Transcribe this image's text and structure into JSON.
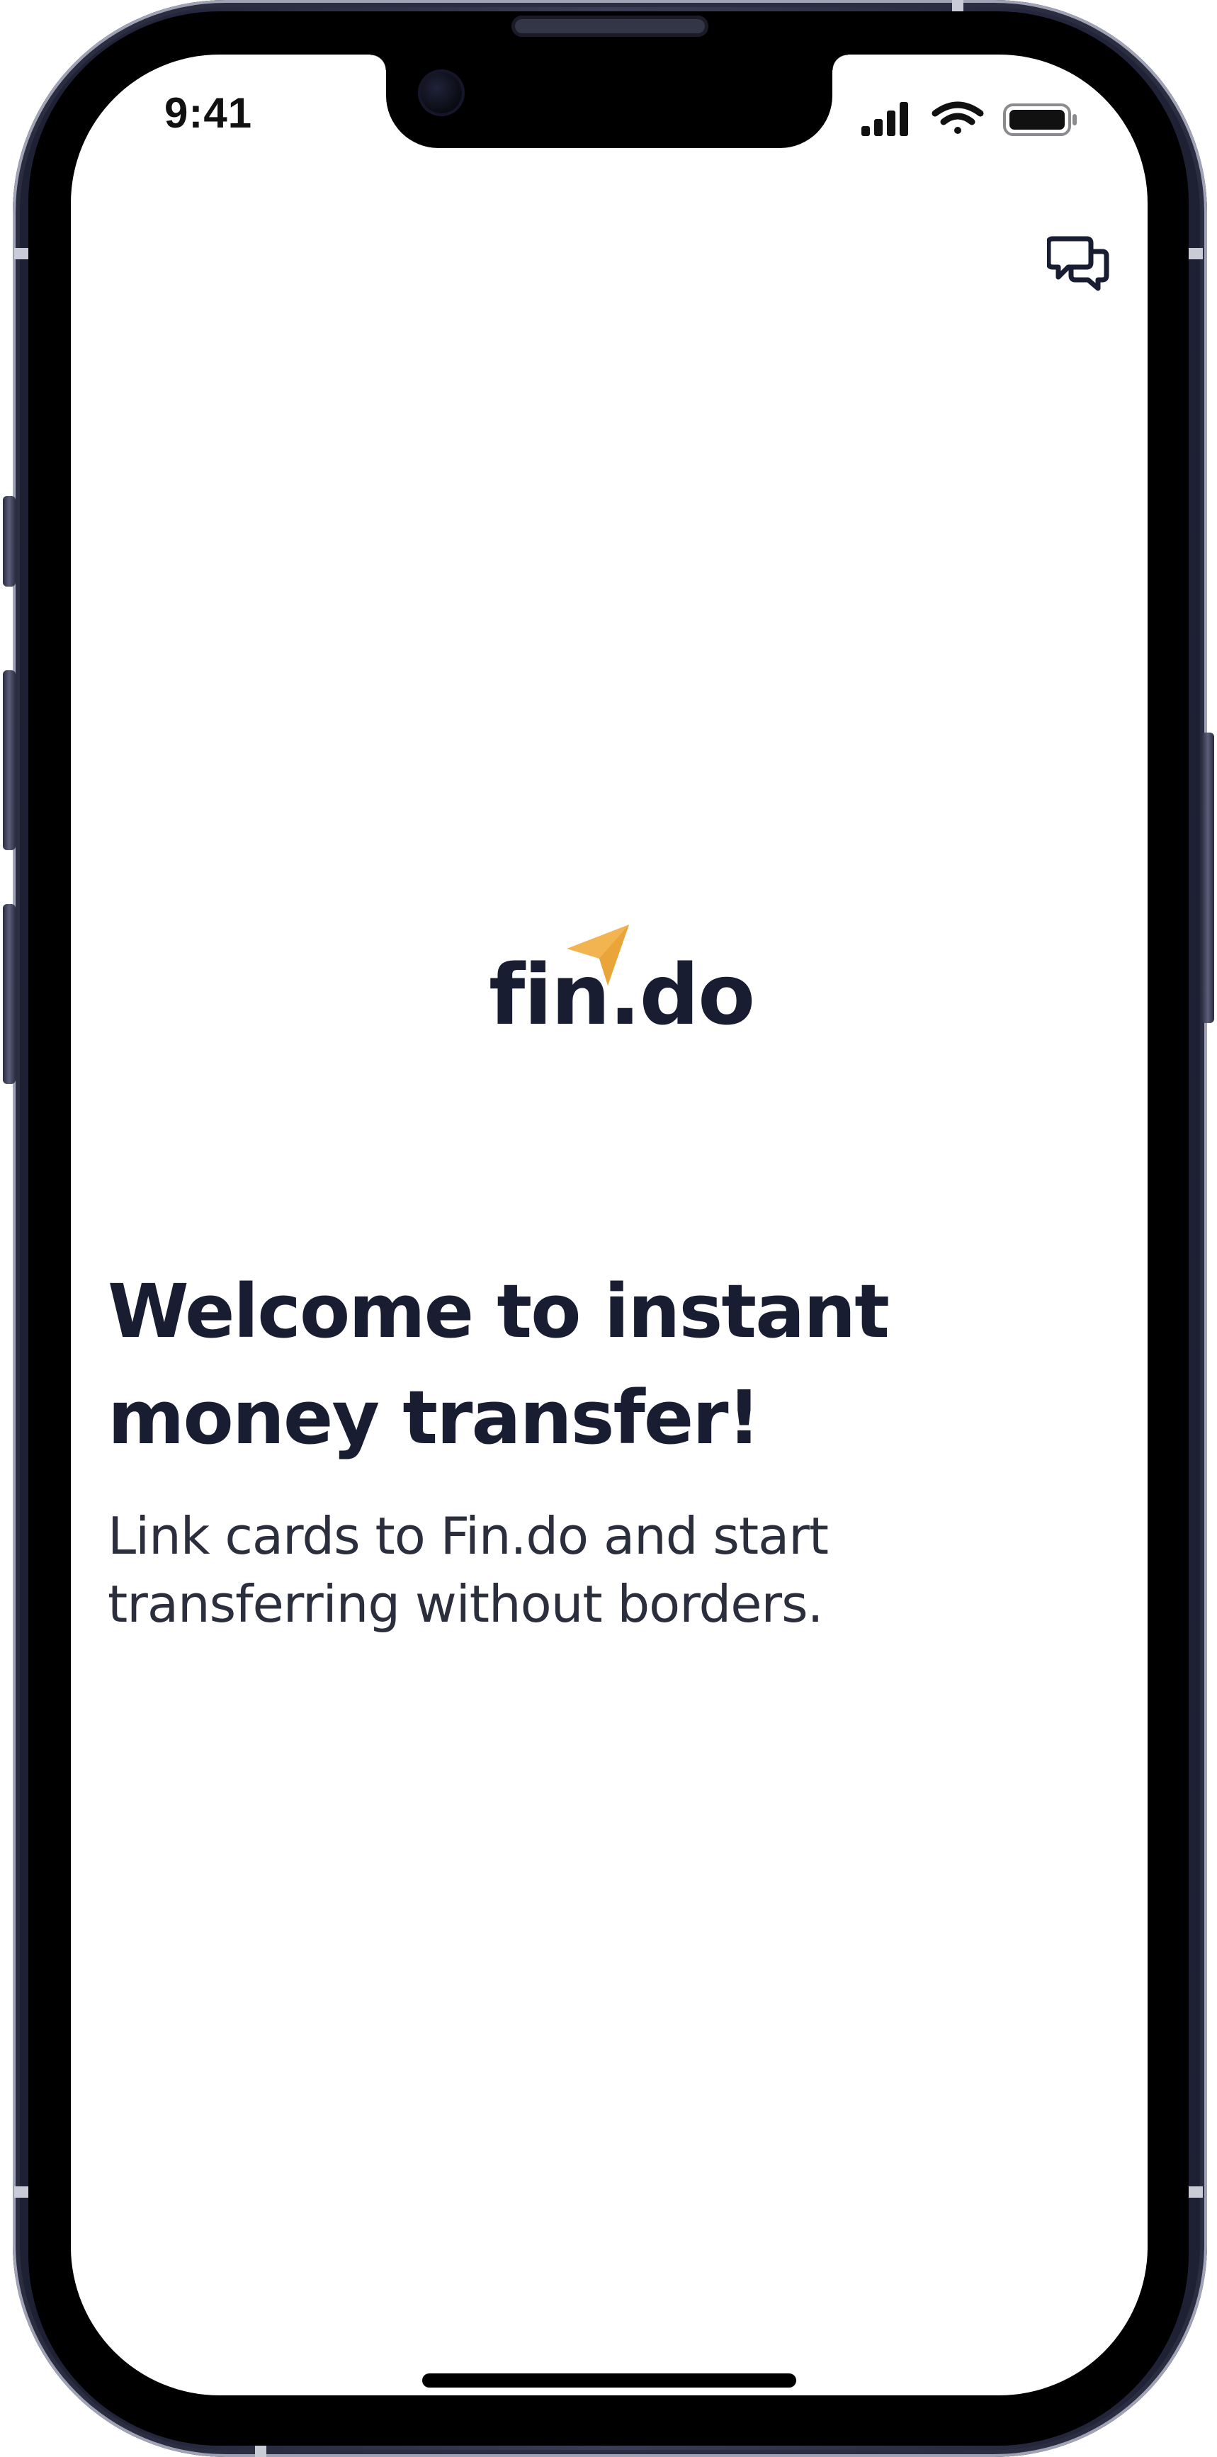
{
  "status_bar": {
    "time": "9:41",
    "signal_icon": "cellular-signal-icon",
    "wifi_icon": "wifi-icon",
    "battery_icon": "battery-icon"
  },
  "header": {
    "support_icon": "chat-bubbles-icon"
  },
  "brand": {
    "logo_text": "fin.do",
    "logo_icon": "paper-plane-icon",
    "accent_color": "#F2B451",
    "text_color": "#191D31"
  },
  "welcome": {
    "title": "Welcome to instant money transfer!",
    "subtitle": "Link cards to Fin.do and start transferring without borders."
  }
}
